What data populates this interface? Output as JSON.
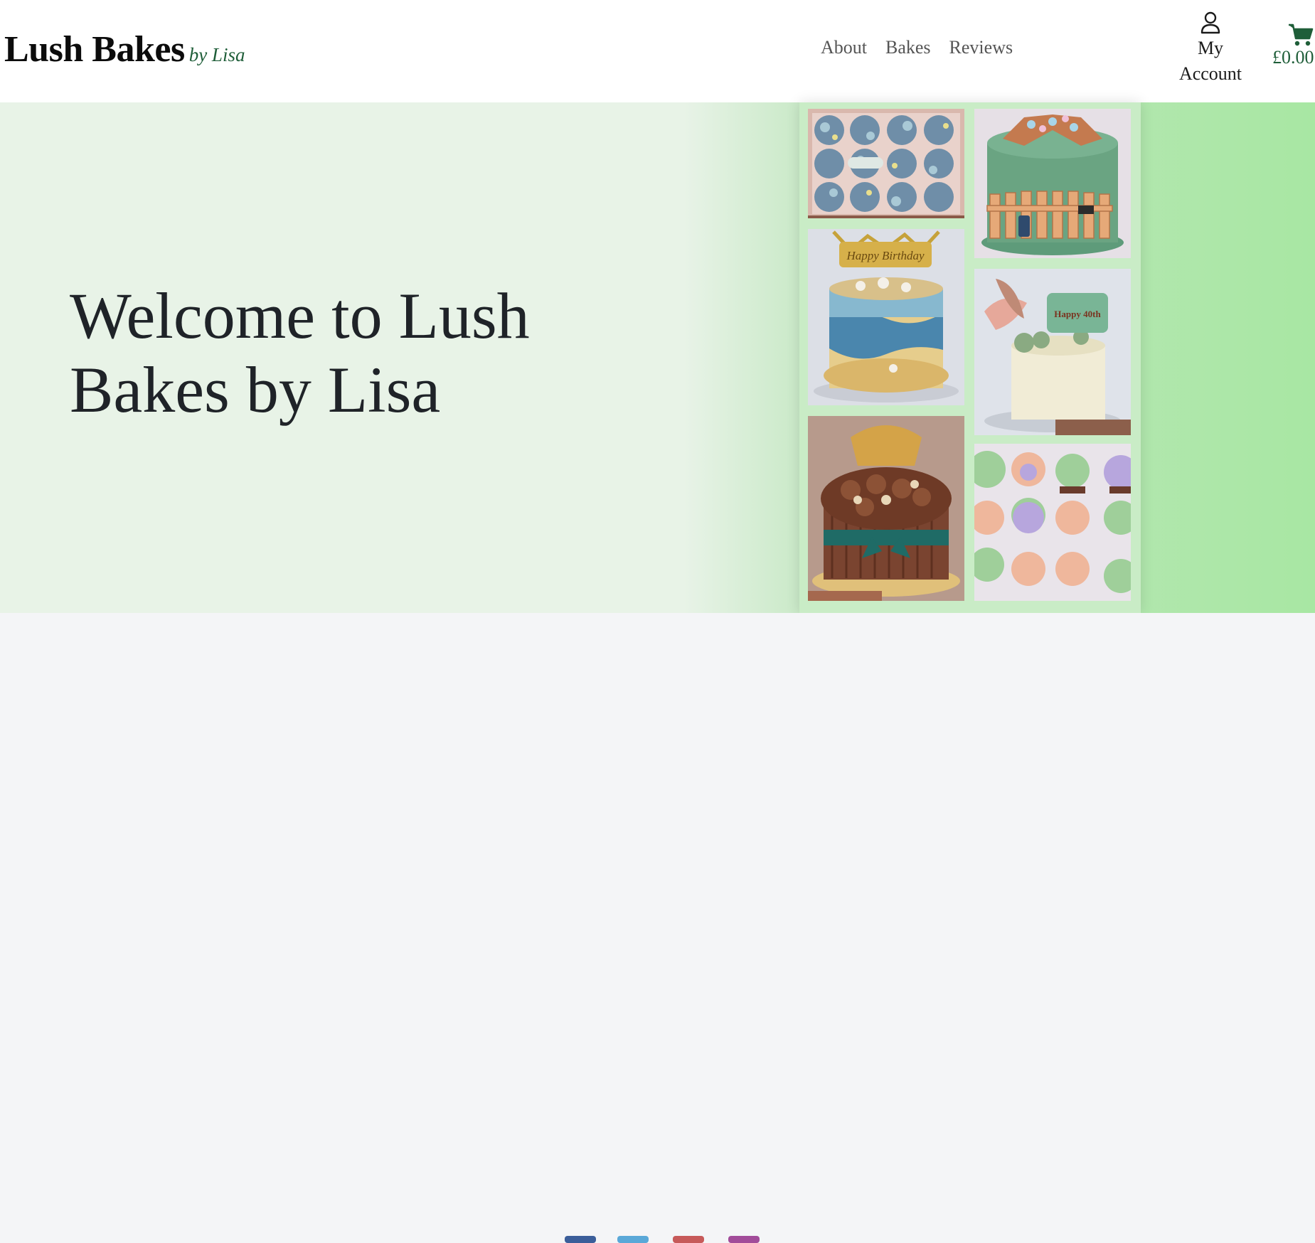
{
  "brand": {
    "name": "Lush Bakes",
    "tagline": "by Lisa"
  },
  "nav": {
    "items": [
      {
        "label": "About"
      },
      {
        "label": "Bakes"
      },
      {
        "label": "Reviews"
      }
    ]
  },
  "account": {
    "label_line1": "My",
    "label_line2": "Account",
    "icon": "user-icon"
  },
  "cart": {
    "total": "£0.00",
    "icon": "cart-icon"
  },
  "hero": {
    "title": "Welcome to Lush Bakes by Lisa",
    "gallery": [
      {
        "name": "blue-cupcakes-box-image"
      },
      {
        "name": "green-garden-fence-cake-image"
      },
      {
        "name": "happy-birthday-beach-cake-image",
        "topper": "Happy Birthday"
      },
      {
        "name": "happy-40th-floral-cake-image",
        "topper": "Happy 40th"
      },
      {
        "name": "chocolate-ribbon-cake-image"
      },
      {
        "name": "pastel-cupcakes-image"
      }
    ]
  },
  "colors": {
    "brand_green": "#1f5e39",
    "hero_bg": "#e8f3e7",
    "hero_accent": "#a8e7a3"
  }
}
